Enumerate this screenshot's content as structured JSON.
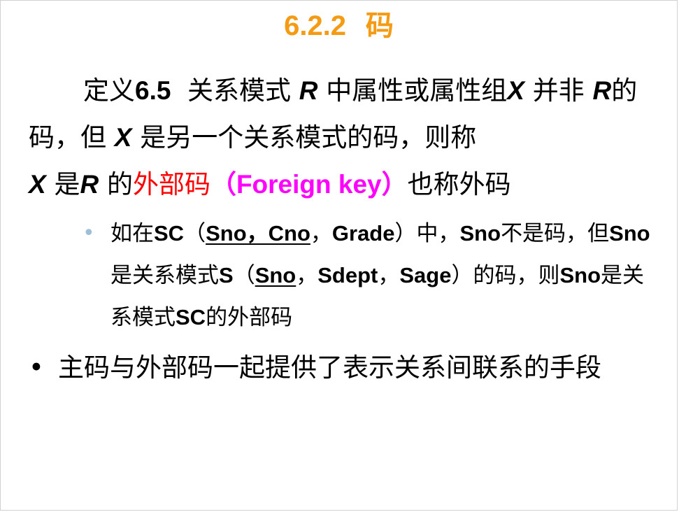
{
  "slide": {
    "title": {
      "number": "6.2.2",
      "text": "码",
      "color": "#f59a13"
    },
    "definition": {
      "label": "定义",
      "number": "6.5",
      "t1": "关系模式",
      "var_r1": "R",
      "t2": "中属性或属性组",
      "var_x1": "X",
      "t3": "并非",
      "var_r2": "R",
      "t4": "的码，但",
      "var_x2": "X",
      "t5": "是另一个关系模式的码，则称",
      "var_x3": "X",
      "t6": "是",
      "var_r3": "R",
      "t7": "的",
      "foreign_zh": "外部码",
      "foreign_zh_color": "#ff0000",
      "foreign_en": "（Foreign key）",
      "foreign_en_color": "#ff00ff",
      "t8": "也称外码"
    },
    "example": {
      "bullet_color": "#9ebfd8",
      "p1": "如在",
      "sc1": "SC",
      "p2": "（",
      "u1": "Sno，Cno",
      "p3": "，",
      "grade": "Grade",
      "p4": "）中，",
      "sno1": "Sno",
      "p5": "不是码，但",
      "sno2": "Sno",
      "p6": "是关系模式",
      "s": "S",
      "p7": "（",
      "u2": "Sno",
      "p8": "，",
      "sdept": "Sdept",
      "p9": "，",
      "sage": "Sage",
      "p10": "）的码，则",
      "sno3": "Sno",
      "p11": "是关系模式",
      "sc2": "SC",
      "p12": "的外部码"
    },
    "bullet": {
      "marker": "•",
      "text": "主码与外部码一起提供了表示关系间联系的手段"
    }
  }
}
